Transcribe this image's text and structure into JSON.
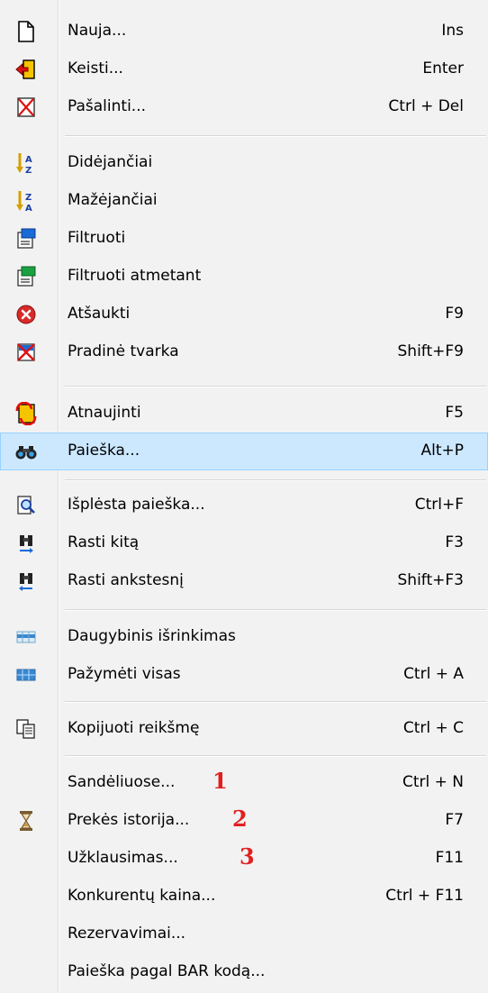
{
  "menu": {
    "items": [
      {
        "label": "Nauja...",
        "shortcut": "Ins",
        "icon": "new-document-icon"
      },
      {
        "label": "Keisti...",
        "shortcut": "Enter",
        "icon": "edit-icon"
      },
      {
        "label": "Pašalinti...",
        "shortcut": "Ctrl + Del",
        "icon": "delete-icon"
      },
      {
        "label": "Didėjančiai",
        "shortcut": "",
        "icon": "sort-ascending-icon"
      },
      {
        "label": "Mažėjančiai",
        "shortcut": "",
        "icon": "sort-descending-icon"
      },
      {
        "label": "Filtruoti",
        "shortcut": "",
        "icon": "filter-icon"
      },
      {
        "label": "Filtruoti atmetant",
        "shortcut": "",
        "icon": "filter-exclude-icon"
      },
      {
        "label": "Atšaukti",
        "shortcut": "F9",
        "icon": "cancel-icon"
      },
      {
        "label": "Pradinė tvarka",
        "shortcut": "Shift+F9",
        "icon": "reset-order-icon"
      },
      {
        "label": "Atnaujinti",
        "shortcut": "F5",
        "icon": "refresh-icon"
      },
      {
        "label": "Paieška...",
        "shortcut": "Alt+P",
        "icon": "binoculars-icon"
      },
      {
        "label": "Išplėsta paieška...",
        "shortcut": "Ctrl+F",
        "icon": "advanced-search-icon"
      },
      {
        "label": "Rasti kitą",
        "shortcut": "F3",
        "icon": "find-next-icon"
      },
      {
        "label": "Rasti ankstesnį",
        "shortcut": "Shift+F3",
        "icon": "find-previous-icon"
      },
      {
        "label": "Daugybinis išrinkimas",
        "shortcut": "",
        "icon": "multi-select-icon"
      },
      {
        "label": "Pažymėti visas",
        "shortcut": "Ctrl + A",
        "icon": "select-all-icon"
      },
      {
        "label": "Kopijuoti reikšmę",
        "shortcut": "Ctrl + C",
        "icon": "copy-icon"
      },
      {
        "label": "Sandėliuose...",
        "shortcut": "Ctrl + N",
        "icon": ""
      },
      {
        "label": "Prekės istorija...",
        "shortcut": "F7",
        "icon": "hourglass-icon"
      },
      {
        "label": "Užklausimas...",
        "shortcut": "F11",
        "icon": ""
      },
      {
        "label": "Konkurentų kaina...",
        "shortcut": "Ctrl + F11",
        "icon": ""
      },
      {
        "label": "Rezervavimai...",
        "shortcut": "",
        "icon": ""
      },
      {
        "label": "Paieška pagal BAR kodą...",
        "shortcut": "",
        "icon": ""
      }
    ],
    "highlighted_label": "Paieška..."
  },
  "annotations": [
    "1",
    "2",
    "3"
  ],
  "colors": {
    "background": "#f2f2f2",
    "highlight": "#cce8ff",
    "highlight_border": "#99d1ff",
    "annotation": "#e02020"
  }
}
